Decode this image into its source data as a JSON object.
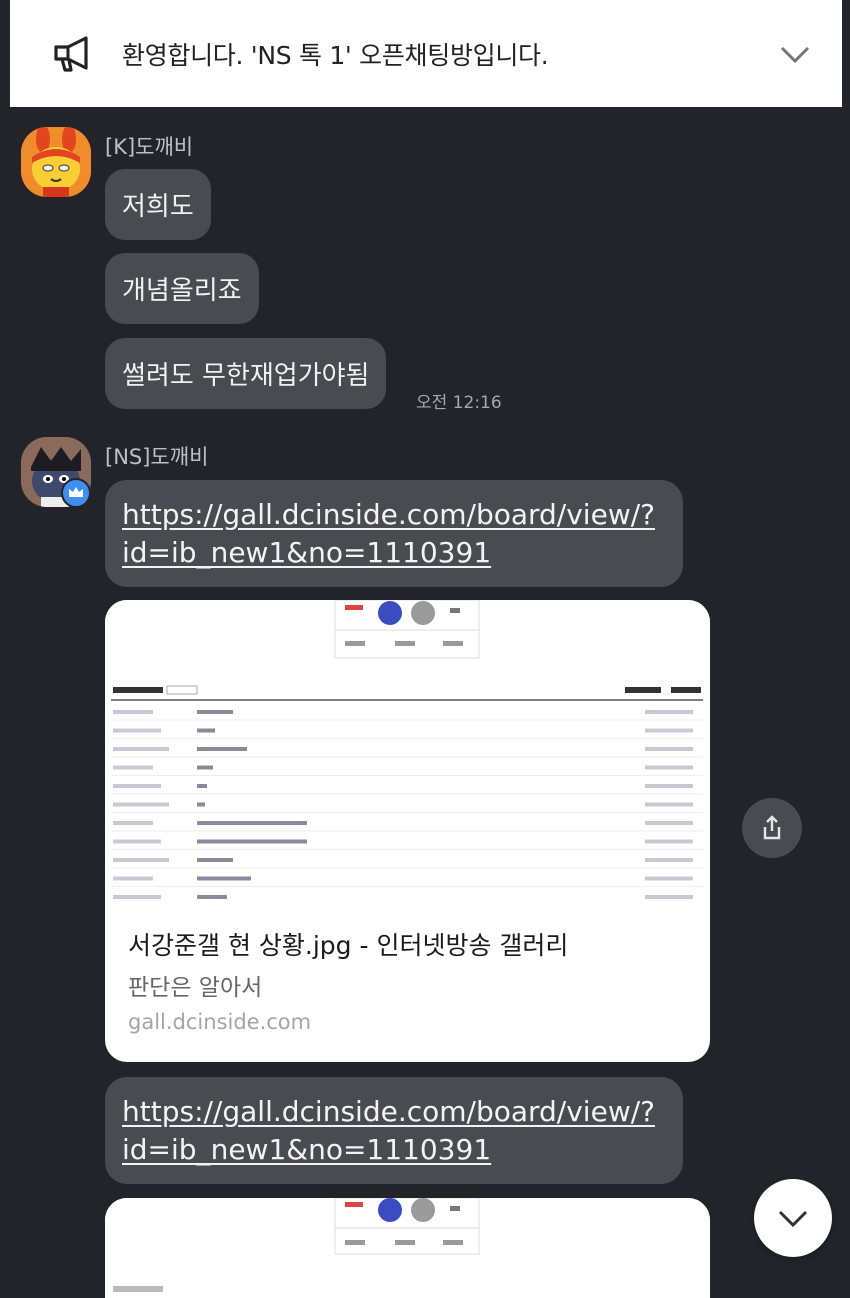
{
  "notice": {
    "text": "환영합니다. 'NS 톡 1' 오픈채팅방입니다.",
    "icon": "megaphone-icon",
    "toggle_icon": "chevron-down-icon"
  },
  "messages": [
    {
      "sender": "[K]도깨비",
      "bubbles": [
        "저희도",
        "개념올리죠",
        "썰려도 무한재업가야됨"
      ],
      "time": "오전 12:16"
    },
    {
      "sender": "[NS]도깨비",
      "link1_line1": "https://gall.dcinside.com/board/view/?",
      "link1_line2": "id=ib_new1&no=1110391",
      "preview": {
        "title": "서강준갤 현 상황.jpg - 인터넷방송 갤러리",
        "description": "판단은 알아서",
        "domain": "gall.dcinside.com"
      },
      "link2_line1": "https://gall.dcinside.com/board/view/?",
      "link2_line2": "id=ib_new1&no=1110391"
    }
  ],
  "colors": {
    "background": "#23242a",
    "bubble": "#4a4b51",
    "notice_bg": "#ffffff"
  }
}
